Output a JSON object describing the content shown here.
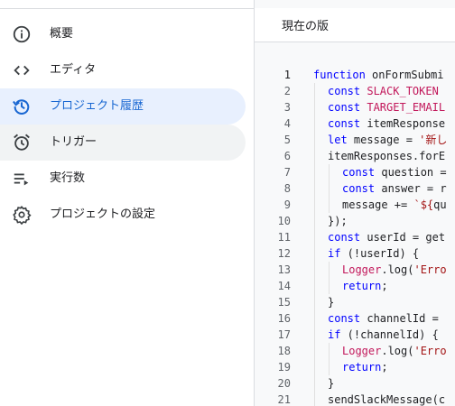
{
  "sidebar": {
    "items": [
      {
        "label": "概要",
        "icon": "info-icon"
      },
      {
        "label": "エディタ",
        "icon": "code-icon"
      },
      {
        "label": "プロジェクト履歴",
        "icon": "history-icon"
      },
      {
        "label": "トリガー",
        "icon": "alarm-icon"
      },
      {
        "label": "実行数",
        "icon": "executions-icon"
      },
      {
        "label": "プロジェクトの設定",
        "icon": "gear-icon"
      }
    ],
    "active_index": 2
  },
  "main": {
    "title": "現在の版"
  },
  "code": {
    "current_line": 1,
    "lines": [
      {
        "n": "1",
        "indent": 0,
        "tokens": [
          [
            "kw",
            "function"
          ],
          [
            "fn",
            " onFormSubmi"
          ]
        ]
      },
      {
        "n": "2",
        "indent": 1,
        "tokens": [
          [
            "kw",
            "const"
          ],
          [
            "fn",
            " "
          ],
          [
            "cst",
            "SLACK_TOKEN"
          ]
        ]
      },
      {
        "n": "3",
        "indent": 1,
        "tokens": [
          [
            "kw",
            "const"
          ],
          [
            "fn",
            " "
          ],
          [
            "cst",
            "TARGET_EMAIL"
          ]
        ]
      },
      {
        "n": "4",
        "indent": 1,
        "tokens": [
          [
            "kw",
            "const"
          ],
          [
            "fn",
            " itemResponse"
          ]
        ]
      },
      {
        "n": "5",
        "indent": 1,
        "tokens": [
          [
            "kw",
            "let"
          ],
          [
            "fn",
            " message = "
          ],
          [
            "str",
            "'新し"
          ]
        ]
      },
      {
        "n": "6",
        "indent": 1,
        "tokens": [
          [
            "fn",
            "itemResponses.forE"
          ]
        ]
      },
      {
        "n": "7",
        "indent": 2,
        "tokens": [
          [
            "kw",
            "const"
          ],
          [
            "fn",
            " question ="
          ]
        ]
      },
      {
        "n": "8",
        "indent": 2,
        "tokens": [
          [
            "kw",
            "const"
          ],
          [
            "fn",
            " answer = r"
          ]
        ]
      },
      {
        "n": "9",
        "indent": 2,
        "tokens": [
          [
            "fn",
            "message += "
          ],
          [
            "str",
            "`${"
          ],
          [
            "fn",
            "qu"
          ]
        ]
      },
      {
        "n": "10",
        "indent": 1,
        "tokens": [
          [
            "fn",
            "});"
          ]
        ]
      },
      {
        "n": "11",
        "indent": 1,
        "tokens": [
          [
            "kw",
            "const"
          ],
          [
            "fn",
            " userId = get"
          ]
        ]
      },
      {
        "n": "12",
        "indent": 1,
        "tokens": [
          [
            "kw",
            "if"
          ],
          [
            "fn",
            " (!userId) {"
          ]
        ]
      },
      {
        "n": "13",
        "indent": 2,
        "tokens": [
          [
            "cst",
            "Logger"
          ],
          [
            "fn",
            ".log("
          ],
          [
            "str",
            "'Erro"
          ]
        ]
      },
      {
        "n": "14",
        "indent": 2,
        "tokens": [
          [
            "kw",
            "return"
          ],
          [
            "fn",
            ";"
          ]
        ]
      },
      {
        "n": "15",
        "indent": 1,
        "tokens": [
          [
            "fn",
            "}"
          ]
        ]
      },
      {
        "n": "16",
        "indent": 1,
        "tokens": [
          [
            "kw",
            "const"
          ],
          [
            "fn",
            " channelId ="
          ]
        ]
      },
      {
        "n": "17",
        "indent": 1,
        "tokens": [
          [
            "kw",
            "if"
          ],
          [
            "fn",
            " (!channelId) {"
          ]
        ]
      },
      {
        "n": "18",
        "indent": 2,
        "tokens": [
          [
            "cst",
            "Logger"
          ],
          [
            "fn",
            ".log("
          ],
          [
            "str",
            "'Erro"
          ]
        ]
      },
      {
        "n": "19",
        "indent": 2,
        "tokens": [
          [
            "kw",
            "return"
          ],
          [
            "fn",
            ";"
          ]
        ]
      },
      {
        "n": "20",
        "indent": 1,
        "tokens": [
          [
            "fn",
            "}"
          ]
        ]
      },
      {
        "n": "21",
        "indent": 1,
        "tokens": [
          [
            "fn",
            "sendSlackMessage(c"
          ]
        ]
      }
    ]
  }
}
